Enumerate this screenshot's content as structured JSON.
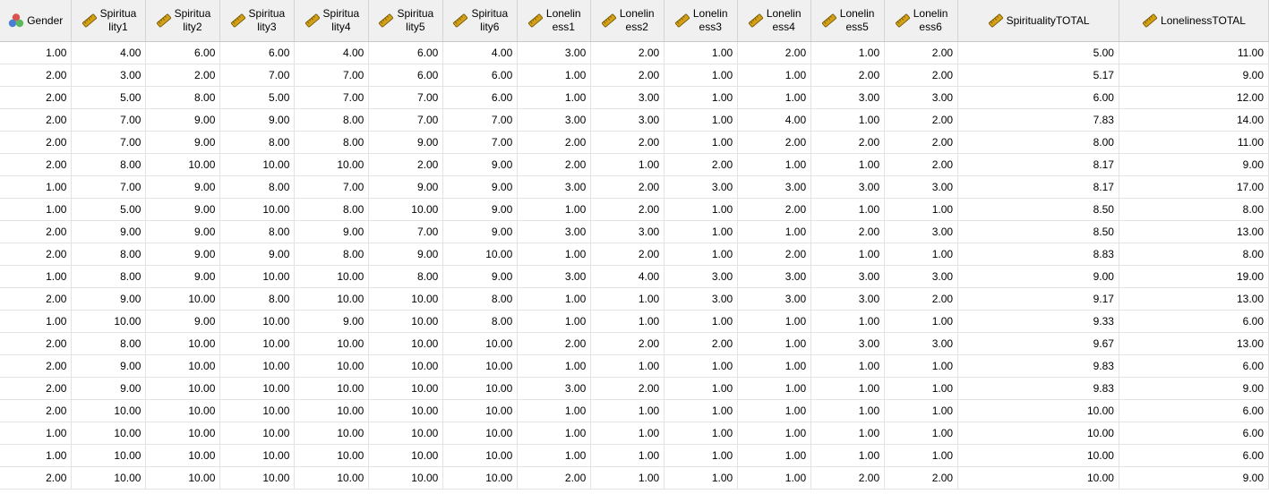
{
  "columns": [
    {
      "line1": "Gender",
      "line2": "",
      "icon": "nominal-measure-icon"
    },
    {
      "line1": "Spiritua",
      "line2": "lity1",
      "icon": "scale-measure-icon"
    },
    {
      "line1": "Spiritua",
      "line2": "lity2",
      "icon": "scale-measure-icon"
    },
    {
      "line1": "Spiritua",
      "line2": "lity3",
      "icon": "scale-measure-icon"
    },
    {
      "line1": "Spiritua",
      "line2": "lity4",
      "icon": "scale-measure-icon"
    },
    {
      "line1": "Spiritua",
      "line2": "lity5",
      "icon": "scale-measure-icon"
    },
    {
      "line1": "Spiritua",
      "line2": "lity6",
      "icon": "scale-measure-icon"
    },
    {
      "line1": "Lonelin",
      "line2": "ess1",
      "icon": "scale-measure-icon"
    },
    {
      "line1": "Lonelin",
      "line2": "ess2",
      "icon": "scale-measure-icon"
    },
    {
      "line1": "Lonelin",
      "line2": "ess3",
      "icon": "scale-measure-icon"
    },
    {
      "line1": "Lonelin",
      "line2": "ess4",
      "icon": "scale-measure-icon"
    },
    {
      "line1": "Lonelin",
      "line2": "ess5",
      "icon": "scale-measure-icon"
    },
    {
      "line1": "Lonelin",
      "line2": "ess6",
      "icon": "scale-measure-icon"
    },
    {
      "line1": "SpiritualityTOTAL",
      "line2": "",
      "icon": "scale-measure-icon"
    },
    {
      "line1": "LonelinessTOTAL",
      "line2": "",
      "icon": "scale-measure-icon"
    }
  ],
  "colors": {
    "scale_icon": "#d4a017",
    "nominal_red": "#d9534f",
    "nominal_blue": "#4a7fd1",
    "nominal_green": "#5cb85c",
    "header_bg": "#f0f0f0",
    "grid_line": "#e3e3e3"
  },
  "rows": [
    [
      "1.00",
      "4.00",
      "6.00",
      "6.00",
      "4.00",
      "6.00",
      "4.00",
      "3.00",
      "2.00",
      "1.00",
      "2.00",
      "1.00",
      "2.00",
      "5.00",
      "11.00"
    ],
    [
      "2.00",
      "3.00",
      "2.00",
      "7.00",
      "7.00",
      "6.00",
      "6.00",
      "1.00",
      "2.00",
      "1.00",
      "1.00",
      "2.00",
      "2.00",
      "5.17",
      "9.00"
    ],
    [
      "2.00",
      "5.00",
      "8.00",
      "5.00",
      "7.00",
      "7.00",
      "6.00",
      "1.00",
      "3.00",
      "1.00",
      "1.00",
      "3.00",
      "3.00",
      "6.00",
      "12.00"
    ],
    [
      "2.00",
      "7.00",
      "9.00",
      "9.00",
      "8.00",
      "7.00",
      "7.00",
      "3.00",
      "3.00",
      "1.00",
      "4.00",
      "1.00",
      "2.00",
      "7.83",
      "14.00"
    ],
    [
      "2.00",
      "7.00",
      "9.00",
      "8.00",
      "8.00",
      "9.00",
      "7.00",
      "2.00",
      "2.00",
      "1.00",
      "2.00",
      "2.00",
      "2.00",
      "8.00",
      "11.00"
    ],
    [
      "2.00",
      "8.00",
      "10.00",
      "10.00",
      "10.00",
      "2.00",
      "9.00",
      "2.00",
      "1.00",
      "2.00",
      "1.00",
      "1.00",
      "2.00",
      "8.17",
      "9.00"
    ],
    [
      "1.00",
      "7.00",
      "9.00",
      "8.00",
      "7.00",
      "9.00",
      "9.00",
      "3.00",
      "2.00",
      "3.00",
      "3.00",
      "3.00",
      "3.00",
      "8.17",
      "17.00"
    ],
    [
      "1.00",
      "5.00",
      "9.00",
      "10.00",
      "8.00",
      "10.00",
      "9.00",
      "1.00",
      "2.00",
      "1.00",
      "2.00",
      "1.00",
      "1.00",
      "8.50",
      "8.00"
    ],
    [
      "2.00",
      "9.00",
      "9.00",
      "8.00",
      "9.00",
      "7.00",
      "9.00",
      "3.00",
      "3.00",
      "1.00",
      "1.00",
      "2.00",
      "3.00",
      "8.50",
      "13.00"
    ],
    [
      "2.00",
      "8.00",
      "9.00",
      "9.00",
      "8.00",
      "9.00",
      "10.00",
      "1.00",
      "2.00",
      "1.00",
      "2.00",
      "1.00",
      "1.00",
      "8.83",
      "8.00"
    ],
    [
      "1.00",
      "8.00",
      "9.00",
      "10.00",
      "10.00",
      "8.00",
      "9.00",
      "3.00",
      "4.00",
      "3.00",
      "3.00",
      "3.00",
      "3.00",
      "9.00",
      "19.00"
    ],
    [
      "2.00",
      "9.00",
      "10.00",
      "8.00",
      "10.00",
      "10.00",
      "8.00",
      "1.00",
      "1.00",
      "3.00",
      "3.00",
      "3.00",
      "2.00",
      "9.17",
      "13.00"
    ],
    [
      "1.00",
      "10.00",
      "9.00",
      "10.00",
      "9.00",
      "10.00",
      "8.00",
      "1.00",
      "1.00",
      "1.00",
      "1.00",
      "1.00",
      "1.00",
      "9.33",
      "6.00"
    ],
    [
      "2.00",
      "8.00",
      "10.00",
      "10.00",
      "10.00",
      "10.00",
      "10.00",
      "2.00",
      "2.00",
      "2.00",
      "1.00",
      "3.00",
      "3.00",
      "9.67",
      "13.00"
    ],
    [
      "2.00",
      "9.00",
      "10.00",
      "10.00",
      "10.00",
      "10.00",
      "10.00",
      "1.00",
      "1.00",
      "1.00",
      "1.00",
      "1.00",
      "1.00",
      "9.83",
      "6.00"
    ],
    [
      "2.00",
      "9.00",
      "10.00",
      "10.00",
      "10.00",
      "10.00",
      "10.00",
      "3.00",
      "2.00",
      "1.00",
      "1.00",
      "1.00",
      "1.00",
      "9.83",
      "9.00"
    ],
    [
      "2.00",
      "10.00",
      "10.00",
      "10.00",
      "10.00",
      "10.00",
      "10.00",
      "1.00",
      "1.00",
      "1.00",
      "1.00",
      "1.00",
      "1.00",
      "10.00",
      "6.00"
    ],
    [
      "1.00",
      "10.00",
      "10.00",
      "10.00",
      "10.00",
      "10.00",
      "10.00",
      "1.00",
      "1.00",
      "1.00",
      "1.00",
      "1.00",
      "1.00",
      "10.00",
      "6.00"
    ],
    [
      "1.00",
      "10.00",
      "10.00",
      "10.00",
      "10.00",
      "10.00",
      "10.00",
      "1.00",
      "1.00",
      "1.00",
      "1.00",
      "1.00",
      "1.00",
      "10.00",
      "6.00"
    ],
    [
      "2.00",
      "10.00",
      "10.00",
      "10.00",
      "10.00",
      "10.00",
      "10.00",
      "2.00",
      "1.00",
      "1.00",
      "1.00",
      "2.00",
      "2.00",
      "10.00",
      "9.00"
    ]
  ]
}
